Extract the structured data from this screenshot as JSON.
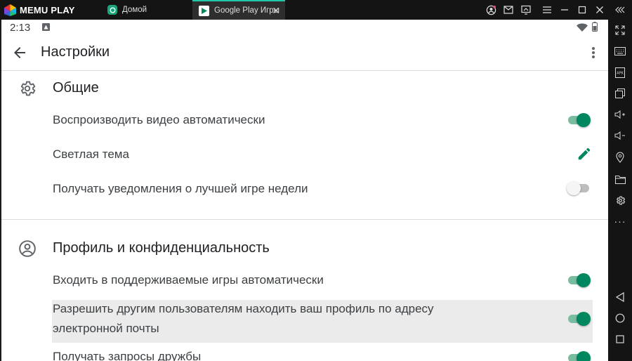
{
  "emulator": {
    "brand": "MEMU PLAY",
    "tabs": [
      {
        "label": "Домой"
      },
      {
        "label": "Google Play Игры",
        "close": "✕"
      }
    ],
    "window_controls": [
      "account-icon",
      "mail-icon",
      "screen-share-icon",
      "menu-icon",
      "minimize-icon",
      "maximize-icon",
      "close-icon",
      "collapse-icon"
    ],
    "sidebar_tools": [
      "fullscreen-icon",
      "keyboard-icon",
      "apk-icon",
      "multi-window-icon",
      "volume-up-icon",
      "volume-down-icon",
      "location-icon",
      "folder-icon",
      "settings-icon",
      "more-icon",
      "nav-back-icon",
      "nav-home-icon",
      "nav-recents-icon"
    ],
    "more_label": "···"
  },
  "statusbar": {
    "time": "2:13"
  },
  "appbar": {
    "title": "Настройки"
  },
  "sections": [
    {
      "title": "Общие",
      "icon": "gear-icon",
      "rows": [
        {
          "label": "Воспроизводить видео автоматически",
          "control": "toggle",
          "on": true
        },
        {
          "label": "Светлая тема",
          "control": "edit"
        },
        {
          "label": "Получать уведомления о лучшей игре недели",
          "control": "toggle",
          "on": false
        }
      ]
    },
    {
      "title": "Профиль и конфиденциальность",
      "icon": "account-circle-icon",
      "rows": [
        {
          "label": "Входить в поддерживаемые игры автоматически",
          "control": "toggle",
          "on": true
        },
        {
          "label_line1": "Разрешить другим пользователям находить ваш профиль по адресу",
          "label_line2": "электронной почты",
          "control": "toggle",
          "on": true
        },
        {
          "label": "Получать запросы дружбы",
          "control": "toggle",
          "on": true
        }
      ]
    }
  ],
  "colors": {
    "accent": "#01875f",
    "accent_track": "#79bda1",
    "emulator_bg": "#141414",
    "tab_accent": "#22c7a9"
  }
}
